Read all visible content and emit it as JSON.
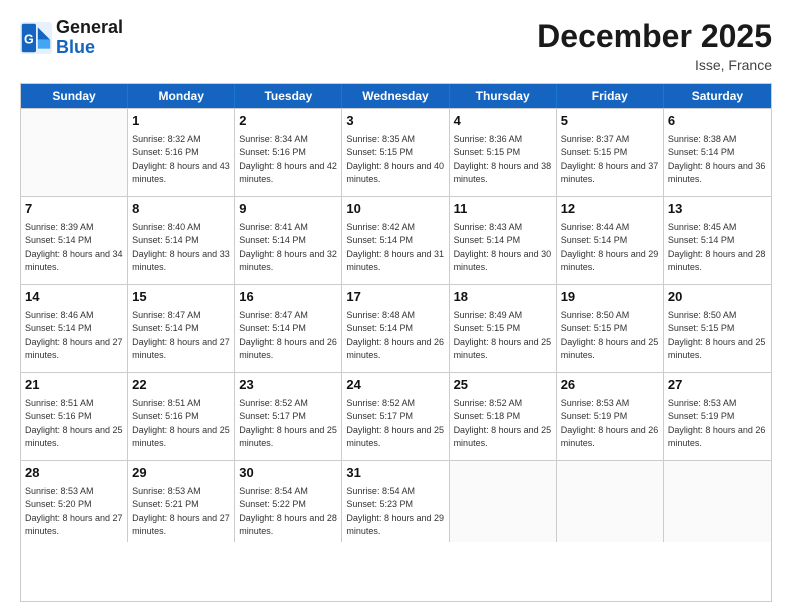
{
  "header": {
    "logo_line1": "General",
    "logo_line2": "Blue",
    "month": "December 2025",
    "location": "Isse, France"
  },
  "days_of_week": [
    "Sunday",
    "Monday",
    "Tuesday",
    "Wednesday",
    "Thursday",
    "Friday",
    "Saturday"
  ],
  "weeks": [
    [
      {
        "day": "",
        "empty": true
      },
      {
        "day": "1",
        "sunrise": "8:32 AM",
        "sunset": "5:16 PM",
        "daylight": "8 hours and 43 minutes."
      },
      {
        "day": "2",
        "sunrise": "8:34 AM",
        "sunset": "5:16 PM",
        "daylight": "8 hours and 42 minutes."
      },
      {
        "day": "3",
        "sunrise": "8:35 AM",
        "sunset": "5:15 PM",
        "daylight": "8 hours and 40 minutes."
      },
      {
        "day": "4",
        "sunrise": "8:36 AM",
        "sunset": "5:15 PM",
        "daylight": "8 hours and 38 minutes."
      },
      {
        "day": "5",
        "sunrise": "8:37 AM",
        "sunset": "5:15 PM",
        "daylight": "8 hours and 37 minutes."
      },
      {
        "day": "6",
        "sunrise": "8:38 AM",
        "sunset": "5:14 PM",
        "daylight": "8 hours and 36 minutes."
      }
    ],
    [
      {
        "day": "7",
        "sunrise": "8:39 AM",
        "sunset": "5:14 PM",
        "daylight": "8 hours and 34 minutes."
      },
      {
        "day": "8",
        "sunrise": "8:40 AM",
        "sunset": "5:14 PM",
        "daylight": "8 hours and 33 minutes."
      },
      {
        "day": "9",
        "sunrise": "8:41 AM",
        "sunset": "5:14 PM",
        "daylight": "8 hours and 32 minutes."
      },
      {
        "day": "10",
        "sunrise": "8:42 AM",
        "sunset": "5:14 PM",
        "daylight": "8 hours and 31 minutes."
      },
      {
        "day": "11",
        "sunrise": "8:43 AM",
        "sunset": "5:14 PM",
        "daylight": "8 hours and 30 minutes."
      },
      {
        "day": "12",
        "sunrise": "8:44 AM",
        "sunset": "5:14 PM",
        "daylight": "8 hours and 29 minutes."
      },
      {
        "day": "13",
        "sunrise": "8:45 AM",
        "sunset": "5:14 PM",
        "daylight": "8 hours and 28 minutes."
      }
    ],
    [
      {
        "day": "14",
        "sunrise": "8:46 AM",
        "sunset": "5:14 PM",
        "daylight": "8 hours and 27 minutes."
      },
      {
        "day": "15",
        "sunrise": "8:47 AM",
        "sunset": "5:14 PM",
        "daylight": "8 hours and 27 minutes."
      },
      {
        "day": "16",
        "sunrise": "8:47 AM",
        "sunset": "5:14 PM",
        "daylight": "8 hours and 26 minutes."
      },
      {
        "day": "17",
        "sunrise": "8:48 AM",
        "sunset": "5:14 PM",
        "daylight": "8 hours and 26 minutes."
      },
      {
        "day": "18",
        "sunrise": "8:49 AM",
        "sunset": "5:15 PM",
        "daylight": "8 hours and 25 minutes."
      },
      {
        "day": "19",
        "sunrise": "8:50 AM",
        "sunset": "5:15 PM",
        "daylight": "8 hours and 25 minutes."
      },
      {
        "day": "20",
        "sunrise": "8:50 AM",
        "sunset": "5:15 PM",
        "daylight": "8 hours and 25 minutes."
      }
    ],
    [
      {
        "day": "21",
        "sunrise": "8:51 AM",
        "sunset": "5:16 PM",
        "daylight": "8 hours and 25 minutes."
      },
      {
        "day": "22",
        "sunrise": "8:51 AM",
        "sunset": "5:16 PM",
        "daylight": "8 hours and 25 minutes."
      },
      {
        "day": "23",
        "sunrise": "8:52 AM",
        "sunset": "5:17 PM",
        "daylight": "8 hours and 25 minutes."
      },
      {
        "day": "24",
        "sunrise": "8:52 AM",
        "sunset": "5:17 PM",
        "daylight": "8 hours and 25 minutes."
      },
      {
        "day": "25",
        "sunrise": "8:52 AM",
        "sunset": "5:18 PM",
        "daylight": "8 hours and 25 minutes."
      },
      {
        "day": "26",
        "sunrise": "8:53 AM",
        "sunset": "5:19 PM",
        "daylight": "8 hours and 26 minutes."
      },
      {
        "day": "27",
        "sunrise": "8:53 AM",
        "sunset": "5:19 PM",
        "daylight": "8 hours and 26 minutes."
      }
    ],
    [
      {
        "day": "28",
        "sunrise": "8:53 AM",
        "sunset": "5:20 PM",
        "daylight": "8 hours and 27 minutes."
      },
      {
        "day": "29",
        "sunrise": "8:53 AM",
        "sunset": "5:21 PM",
        "daylight": "8 hours and 27 minutes."
      },
      {
        "day": "30",
        "sunrise": "8:54 AM",
        "sunset": "5:22 PM",
        "daylight": "8 hours and 28 minutes."
      },
      {
        "day": "31",
        "sunrise": "8:54 AM",
        "sunset": "5:23 PM",
        "daylight": "8 hours and 29 minutes."
      },
      {
        "day": "",
        "empty": true
      },
      {
        "day": "",
        "empty": true
      },
      {
        "day": "",
        "empty": true
      }
    ]
  ]
}
